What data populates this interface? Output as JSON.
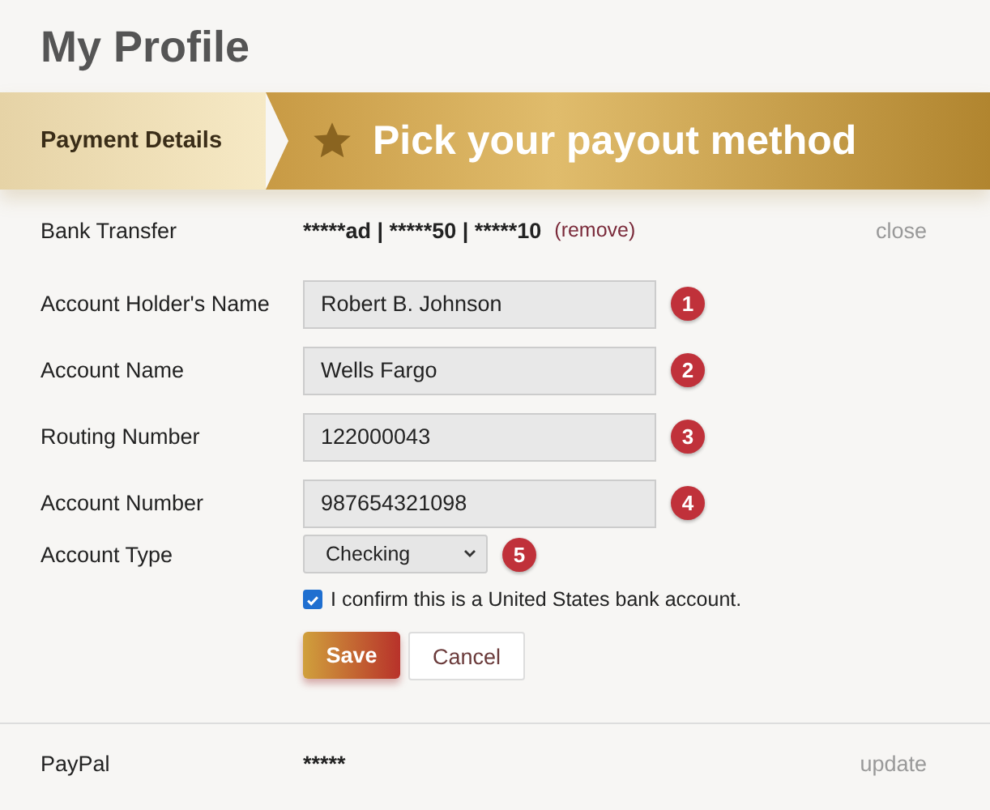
{
  "page": {
    "title": "My Profile"
  },
  "banner": {
    "tab": "Payment Details",
    "heading": "Pick your payout method"
  },
  "bank_transfer": {
    "label": "Bank Transfer",
    "masked": "*****ad | *****50 | *****10",
    "remove_link": "(remove)",
    "close_link": "close"
  },
  "fields": [
    {
      "kind": "text",
      "label": "Account Holder's Name",
      "value": "Robert B. Johnson",
      "marker": "1"
    },
    {
      "kind": "text",
      "label": "Account Name",
      "value": "Wells Fargo",
      "marker": "2"
    },
    {
      "kind": "text",
      "label": "Routing Number",
      "value": "122000043",
      "marker": "3"
    },
    {
      "kind": "text",
      "label": "Account Number",
      "value": "987654321098",
      "marker": "4"
    },
    {
      "kind": "select",
      "label": "Account Type",
      "value": "Checking",
      "marker": "5"
    }
  ],
  "confirm": {
    "label": "I confirm this is a United States bank account.",
    "checked": true
  },
  "buttons": {
    "save": "Save",
    "cancel": "Cancel"
  },
  "paypal": {
    "label": "PayPal",
    "masked": "*****",
    "update_link": "update"
  }
}
